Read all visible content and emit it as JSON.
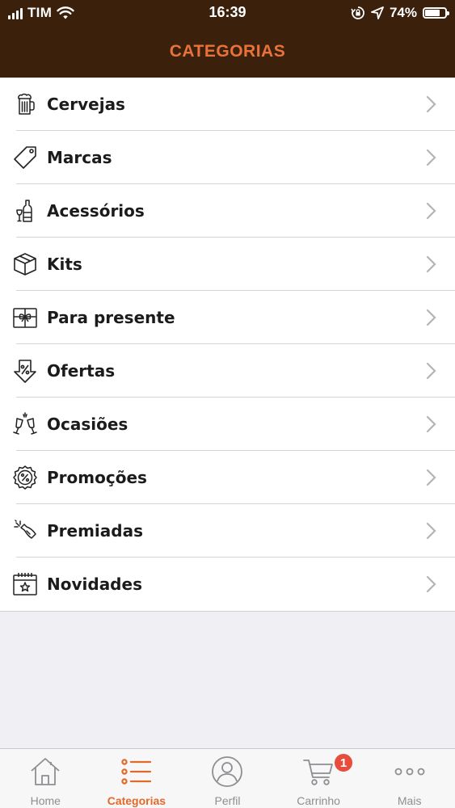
{
  "status_bar": {
    "carrier": "TIM",
    "time": "16:39",
    "battery_percent": "74%",
    "battery_level": 0.74,
    "icons": [
      "signal-icon",
      "wifi-icon",
      "orientation-lock-icon",
      "location-arrow-icon",
      "battery-icon"
    ]
  },
  "header": {
    "title": "CATEGORIAS"
  },
  "colors": {
    "header_bg": "#3b200c",
    "accent": "#e8733a",
    "badge": "#e74c3c",
    "tab_inactive": "#8e8e93"
  },
  "categories": [
    {
      "label": "Cervejas",
      "icon": "beer-mug-icon"
    },
    {
      "label": "Marcas",
      "icon": "price-tag-icon"
    },
    {
      "label": "Acessórios",
      "icon": "bottle-glass-icon"
    },
    {
      "label": "Kits",
      "icon": "box-icon"
    },
    {
      "label": "Para presente",
      "icon": "gift-icon"
    },
    {
      "label": "Ofertas",
      "icon": "percent-down-icon"
    },
    {
      "label": "Ocasiões",
      "icon": "toast-glasses-icon"
    },
    {
      "label": "Promoções",
      "icon": "percent-badge-icon"
    },
    {
      "label": "Premiadas",
      "icon": "champagne-bottle-icon"
    },
    {
      "label": "Novidades",
      "icon": "calendar-star-icon"
    }
  ],
  "tabbar": {
    "tabs": [
      {
        "label": "Home",
        "icon": "home-icon"
      },
      {
        "label": "Categorias",
        "icon": "list-icon",
        "active": true
      },
      {
        "label": "Perfil",
        "icon": "profile-icon"
      },
      {
        "label": "Carrinho",
        "icon": "cart-icon",
        "badge": "1"
      },
      {
        "label": "Mais",
        "icon": "more-icon"
      }
    ]
  }
}
